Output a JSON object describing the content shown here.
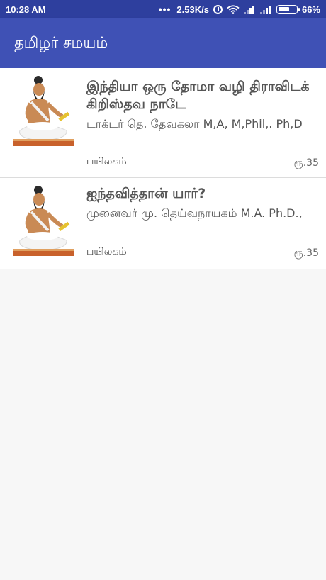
{
  "status_bar": {
    "time": "10:28 AM",
    "network_speed": "2.53K/s",
    "battery": "66%",
    "battery_level": 0.66,
    "icons": [
      "more-dots-icon",
      "alarm-icon",
      "wifi-icon",
      "signal-icon",
      "signal-icon",
      "battery-icon"
    ]
  },
  "app_bar": {
    "title": "தமிழர் சமயம்",
    "color": "#3f51b5"
  },
  "books": [
    {
      "title": "இந்தியா ஒரு தோமா வழி திராவிடக் கிறிஸ்தவ நாடே",
      "author": "டாக்டர் தெ. தேவகலா M,A, M,Phil,. Ph,D",
      "publisher": "பயிலகம்",
      "price": "ரூ.35",
      "image": "thiruvalluvar-thumbnail"
    },
    {
      "title": "ஐந்தவித்தான் யார்?",
      "author": "முனைவர் மு. தெய்வநாயகம் M.A. Ph.D.,",
      "publisher": "பயிலகம்",
      "price": "ரூ.35",
      "image": "thiruvalluvar-thumbnail"
    }
  ]
}
